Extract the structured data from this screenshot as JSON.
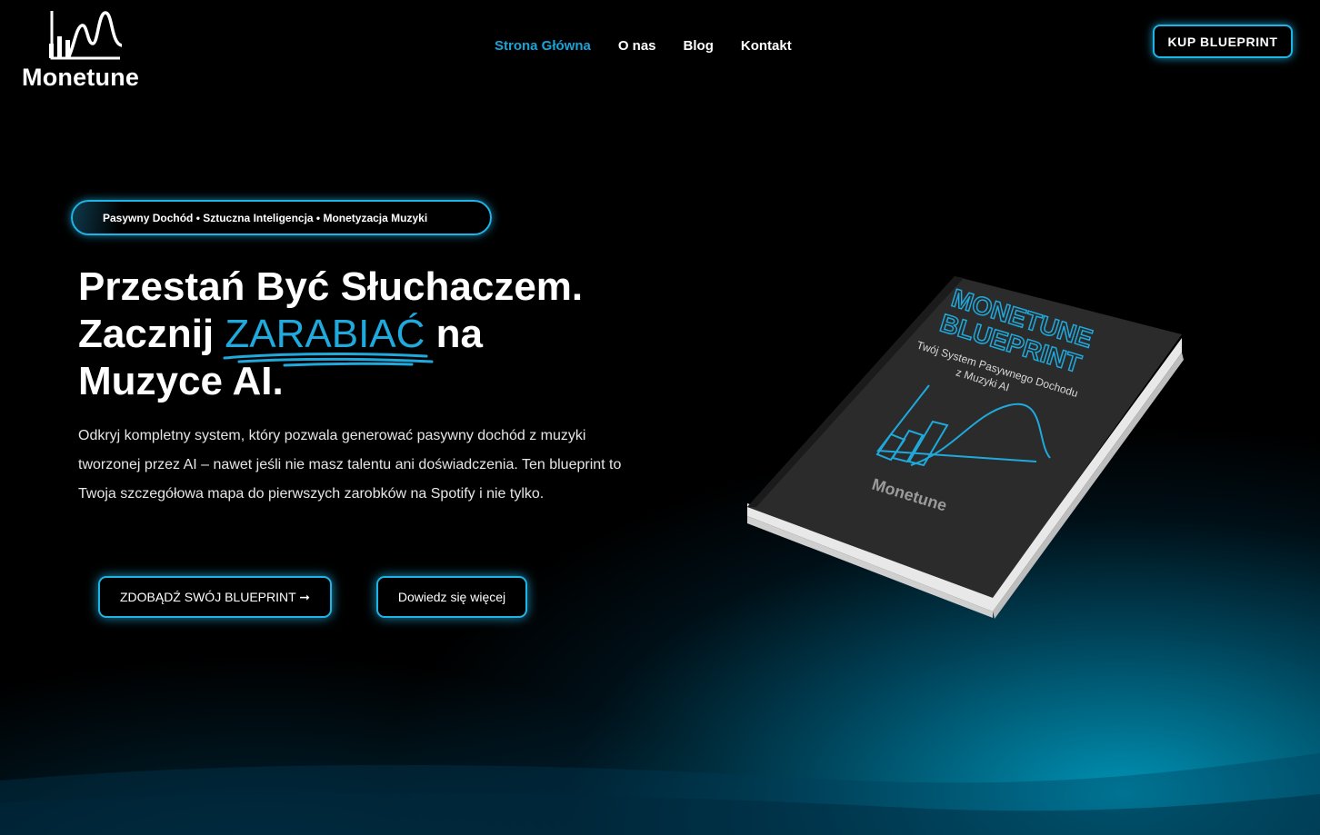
{
  "brand": {
    "name": "Monetune"
  },
  "nav": {
    "items": [
      {
        "label": "Strona Główna",
        "active": true
      },
      {
        "label": "O nas",
        "active": false
      },
      {
        "label": "Blog",
        "active": false
      },
      {
        "label": "Kontakt",
        "active": false
      }
    ],
    "cta_label": "KUP BLUEPRINT"
  },
  "hero": {
    "tagline": "Pasywny Dochód • Sztuczna Inteligencja • Monetyzacja Muzyki",
    "headline_line1": "Przestań Być Słuchaczem.",
    "headline_line2_before": "Zacznij ",
    "headline_highlight": "ZARABIAĆ",
    "headline_line2_after": " na",
    "headline_line3": "Muzyce AI.",
    "description": "Odkryj kompletny system, który pozwala generować pasywny dochód z muzyki tworzonej przez AI – nawet jeśli nie masz talentu ani doświadczenia. Ten blueprint to Twoja szczegółowa mapa do pierwszych zarobków na Spotify i nie tylko.",
    "primary_button": "ZDOBĄDŹ SWÓJ BLUEPRINT ➞",
    "secondary_button": "Dowiedz się więcej"
  },
  "book": {
    "title_line1": "MONETUNE",
    "title_line2": "BLUEPRINT",
    "subtitle_line1": "Twój System Pasywnego Dochodu",
    "subtitle_line2": "z Muzyki AI",
    "publisher": "Monetune",
    "icon": "chart-wave-icon"
  },
  "colors": {
    "accent": "#1fb3e6",
    "nav_active": "#1aa3d6",
    "highlight": "#1fa9dc",
    "background": "#000000",
    "book_cover": "#2a2a2a"
  }
}
